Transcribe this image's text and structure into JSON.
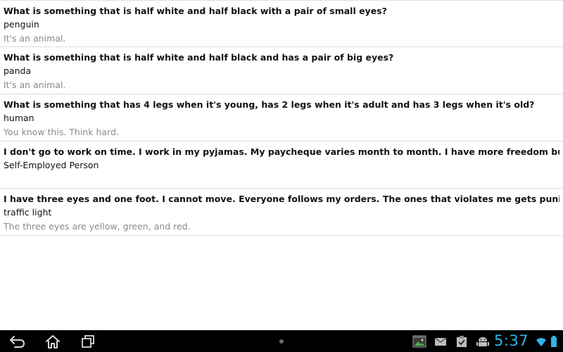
{
  "riddles": [
    {
      "question": "What is something that is half white and half black with a pair of small eyes?",
      "answer": "penguin",
      "hint": "It's an animal."
    },
    {
      "question": "What is something that is half white and half black and has a pair of big eyes?",
      "answer": "panda",
      "hint": "It's an animal."
    },
    {
      "question": "What is something that has 4 legs when it's young, has 2 legs when it's adult and has 3 legs when it's old?",
      "answer": "human",
      "hint": "You know this. Think hard."
    },
    {
      "question": "I don't go to work on time. I work in my pyjamas. My paycheque varies month to month. I have more freedom but also more worries. Who am I?",
      "answer": "Self-Employed Person",
      "hint": ""
    },
    {
      "question": "I have three eyes and one foot. I cannot move. Everyone follows my orders. The ones that violates me gets punished. Guess what am I?",
      "answer": "traffic light",
      "hint": "The three eyes are yellow, green, and red."
    }
  ],
  "system_bar": {
    "time": "5:37",
    "accent_color": "#33b5e5",
    "icons": {
      "back": "back-icon",
      "home": "home-icon",
      "recents": "recent-apps-icon",
      "gallery": "gallery-notification-icon",
      "mail": "mail-notification-icon",
      "clipboard": "clipboard-check-notification-icon",
      "android": "android-notification-icon",
      "wifi": "wifi-icon",
      "battery": "battery-icon"
    }
  }
}
